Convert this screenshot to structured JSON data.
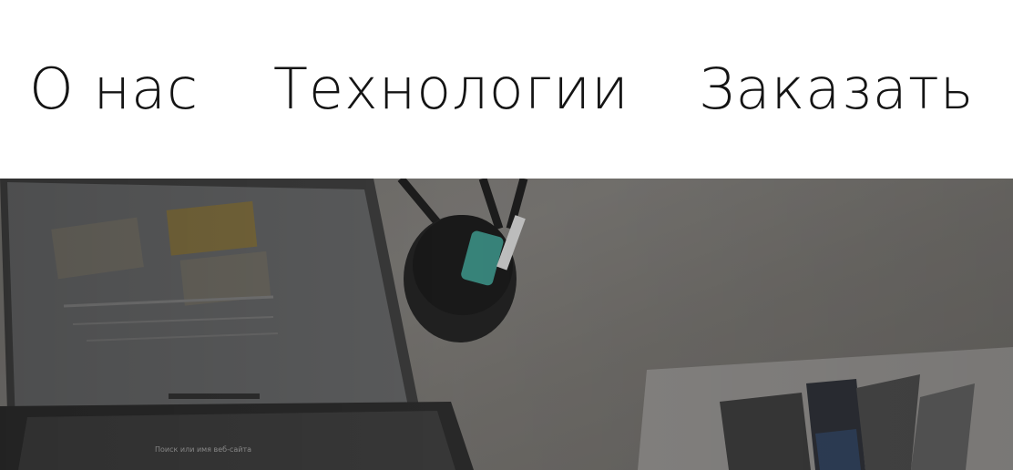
{
  "nav": {
    "items": [
      {
        "label": "О нас"
      },
      {
        "label": "Технологии"
      },
      {
        "label": "Заказать"
      }
    ]
  },
  "hero": {
    "screen_search_text": "Поиск или имя веб-сайта"
  },
  "colors": {
    "nav_text": "#141414",
    "page_background": "#ffffff",
    "hero_tint": "#6f6d69"
  }
}
